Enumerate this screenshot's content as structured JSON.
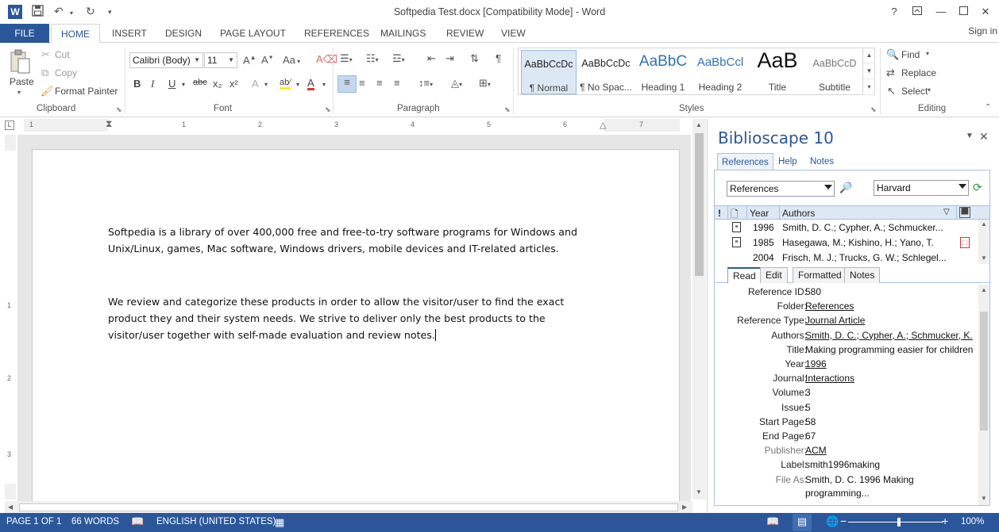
{
  "titlebar": {
    "title": "Softpedia Test.docx [Compatibility Mode] - Word",
    "app_icon": "W",
    "help": "?",
    "min": "—",
    "close": "✕"
  },
  "tabs": [
    "FILE",
    "HOME",
    "INSERT",
    "DESIGN",
    "PAGE LAYOUT",
    "REFERENCES",
    "MAILINGS",
    "REVIEW",
    "VIEW"
  ],
  "signin": "Sign in",
  "clipboard": {
    "paste": "Paste",
    "cut": "Cut",
    "copy": "Copy",
    "format_painter": "Format Painter",
    "label": "Clipboard"
  },
  "font": {
    "family": "Calibri (Body)",
    "size": "11",
    "label": "Font",
    "bold": "B",
    "italic": "I",
    "underline": "U",
    "strike": "abc",
    "sub": "x₂",
    "sup": "x²"
  },
  "paragraph": {
    "label": "Paragraph"
  },
  "styles": {
    "label": "Styles",
    "items": [
      {
        "sample": "AaBbCcDc",
        "name": "¶ Normal"
      },
      {
        "sample": "AaBbCcDc",
        "name": "¶ No Spac..."
      },
      {
        "sample": "AaBbC",
        "name": "Heading 1"
      },
      {
        "sample": "AaBbCcl",
        "name": "Heading 2"
      },
      {
        "sample": "AaB",
        "name": "Title"
      },
      {
        "sample": "AaBbCcD",
        "name": "Subtitle"
      }
    ]
  },
  "editing": {
    "label": "Editing",
    "find": "Find",
    "replace": "Replace",
    "select": "Select"
  },
  "ruler": [
    "1",
    "1",
    "2",
    "3",
    "4",
    "5",
    "6",
    "7"
  ],
  "ruler_v": [
    "1",
    "2",
    "3"
  ],
  "document": {
    "para1": "Softpedia is a library of over 400,000 free and free-to-try software programs for Windows and Unix/Linux, games, Mac software, Windows drivers, mobile devices and IT-related articles.",
    "para2": "We review and categorize these products in order to allow the visitor/user to find the exact product they and their system needs. We strive to deliver only the best products to the visitor/user together with self-made evaluation and review notes."
  },
  "pane": {
    "title": "Biblioscape 10",
    "tabs": [
      "References",
      "Help",
      "Notes"
    ],
    "source_combo": "References",
    "style_combo": "Harvard",
    "grid": {
      "headers": {
        "flag": "!",
        "year": "Year",
        "authors": "Authors"
      },
      "rows": [
        {
          "year": "1996",
          "authors": "Smith, D. C.; Cypher, A.; Schmucker...",
          "pdf": false
        },
        {
          "year": "1985",
          "authors": "Hasegawa, M.; Kishino, H.; Yano, T.",
          "pdf": true
        },
        {
          "year": "2004",
          "authors": "Frisch, M. J.; Trucks, G. W.; Schlegel...",
          "pdf": false
        }
      ]
    },
    "detail_tabs": [
      "Read",
      "Edit",
      "Formatted",
      "Notes"
    ],
    "details": [
      {
        "label": "Reference ID:",
        "value": "580",
        "link": false,
        "grey": false
      },
      {
        "label": "Folder:",
        "value": "References",
        "link": true,
        "grey": false
      },
      {
        "label": "Reference Type:",
        "value": "Journal Article",
        "link": true,
        "grey": false
      },
      {
        "label": "Authors:",
        "value": "Smith, D. C.; Cypher, A.; Schmucker, K.",
        "link": true,
        "grey": false
      },
      {
        "label": "Title:",
        "value": "Making programming easier for children",
        "link": false,
        "grey": false
      },
      {
        "label": "Year:",
        "value": "1996",
        "link": true,
        "grey": false
      },
      {
        "label": "Journal:",
        "value": "Interactions",
        "link": true,
        "grey": false
      },
      {
        "label": "Volume:",
        "value": "3",
        "link": false,
        "grey": false
      },
      {
        "label": "Issue:",
        "value": "5",
        "link": false,
        "grey": false
      },
      {
        "label": "Start Page:",
        "value": "58",
        "link": false,
        "grey": false
      },
      {
        "label": "End Page:",
        "value": "67",
        "link": false,
        "grey": false
      },
      {
        "label": "Publisher:",
        "value": "ACM",
        "link": true,
        "grey": true
      },
      {
        "label": "Label:",
        "value": "smith1996making",
        "link": false,
        "grey": false
      },
      {
        "label": "File As:",
        "value": "Smith, D. C. 1996 Making",
        "link": false,
        "grey": true
      }
    ],
    "file_as_cont": "programming..."
  },
  "status": {
    "page": "PAGE 1 OF 1",
    "words": "66 WORDS",
    "language": "ENGLISH (UNITED STATES)",
    "zoom": "100%"
  },
  "colors": {
    "accent": "#2b579a",
    "pane_frame": "#a9c1e0"
  }
}
